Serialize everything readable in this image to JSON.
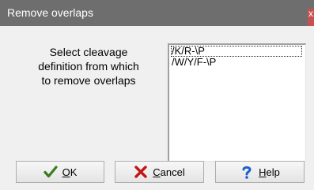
{
  "window": {
    "title": "Remove overlaps",
    "close_glyph": "x"
  },
  "prompt": "Select cleavage\ndefinition from which\nto remove overlaps",
  "listbox": {
    "items": [
      "/K/R-\\P",
      "/W/Y/F-\\P"
    ],
    "selected_index": 0
  },
  "buttons": {
    "ok": {
      "mnemonic": "O",
      "rest": "K",
      "icon": "checkmark-icon",
      "icon_color": "#3a7d1e"
    },
    "cancel": {
      "mnemonic": "C",
      "rest": "ancel",
      "icon": "x-mark-icon",
      "icon_color": "#c21616"
    },
    "help": {
      "mnemonic": "H",
      "rest": "elp",
      "icon": "question-mark-icon",
      "icon_color": "#1f5fcc"
    }
  },
  "colors": {
    "title_bar": "#6e6e6e",
    "close_button": "#c75050",
    "dialog_background": "#f0f0f0"
  }
}
